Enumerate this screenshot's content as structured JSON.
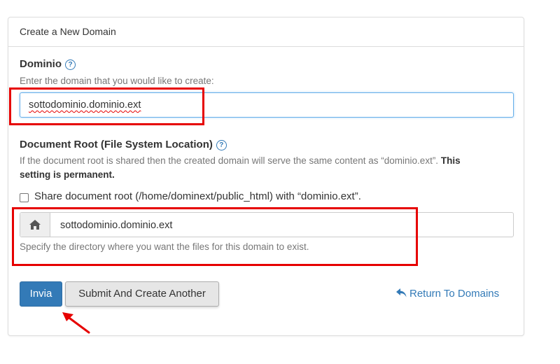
{
  "panel": {
    "title": "Create a New Domain"
  },
  "domain_field": {
    "label": "Dominio",
    "help_glyph": "?",
    "description": "Enter the domain that you would like to create:",
    "value": "sottodominio.dominio.ext"
  },
  "document_root": {
    "label": "Document Root (File System Location)",
    "help_glyph": "?",
    "description_main": "If the document root is shared then the created domain will serve the same content as “dominio.ext”.",
    "description_line1_bold": "This",
    "description_line2_bold": "setting is permanent.",
    "share_checkbox": {
      "checked": false,
      "label": "Share document root (/home/dominext/public_html) with “dominio.ext”."
    },
    "addon_icon": "home-icon",
    "value": "sottodominio.dominio.ext",
    "help_text": "Specify the directory where you want the files for this domain to exist."
  },
  "actions": {
    "submit_label": "Invia",
    "submit_another_label": "Submit And Create Another",
    "return_label": "Return To Domains",
    "return_icon": "reply-arrow-icon"
  },
  "colors": {
    "primary": "#337ab7",
    "highlight": "#e60000"
  }
}
